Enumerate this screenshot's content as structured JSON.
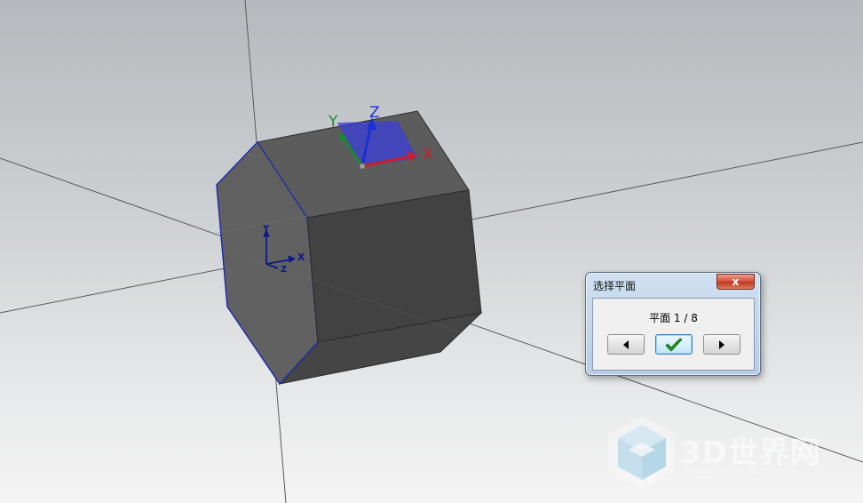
{
  "viewport": {
    "background_top": "#b5b9bd",
    "background_bottom": "#f4f4f4",
    "triad_main": {
      "x_label": "X",
      "y_label": "Y",
      "z_label": "Z",
      "x_color": "#cc1e2a",
      "y_color": "#1b8a2e",
      "z_color": "#1a2fd6"
    },
    "triad_small": {
      "x_label": "X",
      "y_label": "Y",
      "z_label": "Z",
      "color": "#0a1a8a"
    }
  },
  "dialog": {
    "title": "选择平面",
    "close_label": "x",
    "counter": "平面 1 / 8",
    "prev_icon": "triangle-left-icon",
    "ok_icon": "checkmark-icon",
    "next_icon": "triangle-right-icon"
  },
  "watermark": {
    "text": "3D世界网",
    "sub": "WWW.3DSJW.COM"
  }
}
